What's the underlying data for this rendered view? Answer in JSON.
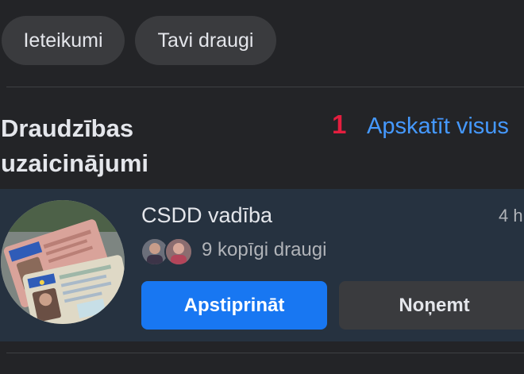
{
  "chips": {
    "suggestions": "Ieteikumi",
    "friends": "Tavi draugi"
  },
  "friend_requests": {
    "title_line1": "Draudzības",
    "title_line2": "uzaicinājumi",
    "count": "1",
    "see_all": "Apskatīt visus"
  },
  "request": {
    "name": "CSDD vadība",
    "time": "4 h",
    "mutual_friends": "9 kopīgi draugi",
    "confirm_label": "Apstiprināt",
    "remove_label": "Noņemt"
  },
  "colors": {
    "background": "#232427",
    "card_highlight": "#263240",
    "accent_blue": "#1877f2",
    "link_blue": "#4599ff",
    "badge_red": "#e41e3f"
  }
}
